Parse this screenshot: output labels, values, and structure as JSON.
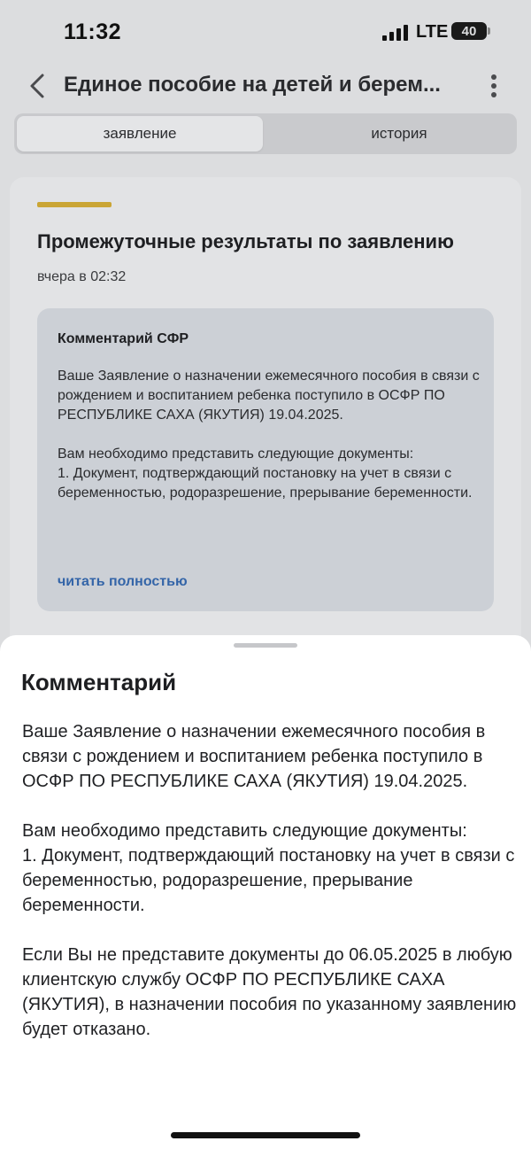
{
  "status_bar": {
    "time": "11:32",
    "network": "LTE",
    "battery": "40"
  },
  "nav": {
    "title": "Единое пособие на детей и берем..."
  },
  "tabs": [
    {
      "label": "заявление",
      "active": true
    },
    {
      "label": "история",
      "active": false
    }
  ],
  "card": {
    "title": "Промежуточные результаты по заявлению",
    "time": "вчера в 02:32",
    "comment_title": "Комментарий СФР",
    "comment_paragraphs": [
      "Ваше Заявление о назначении ежемесячного пособия в связи с рождением и воспитанием ребенка поступило в ОСФР ПО РЕСПУБЛИКЕ САХА (ЯКУТИЯ) 19.04.2025.",
      "Вам необходимо представить следующие документы:",
      "1. Документ, подтверждающий постановку на учет в связи с беременностью, родоразрешение, прерывание беременности."
    ],
    "read_more": "читать полностью"
  },
  "sheet": {
    "title": "Комментарий",
    "paragraphs": [
      "Ваше Заявление о назначении ежемесячного пособия в связи с рождением и воспитанием ребенка поступило в ОСФР ПО РЕСПУБЛИКЕ САХА (ЯКУТИЯ) 19.04.2025.",
      "Вам необходимо представить следующие документы:",
      "1. Документ, подтверждающий постановку на учет в связи с беременностью, родоразрешение, прерывание беременности.",
      "Если Вы не представите документы до 06.05.2025 в любую клиентскую службу ОСФР ПО РЕСПУБЛИКЕ САХА (ЯКУТИЯ), в назначении пособия по указанному заявлению будет отказано."
    ]
  },
  "colors": {
    "accent": "#caa534",
    "link": "#3465a8"
  },
  "icons": [
    "signal-icon",
    "back-icon",
    "more-icon"
  ]
}
